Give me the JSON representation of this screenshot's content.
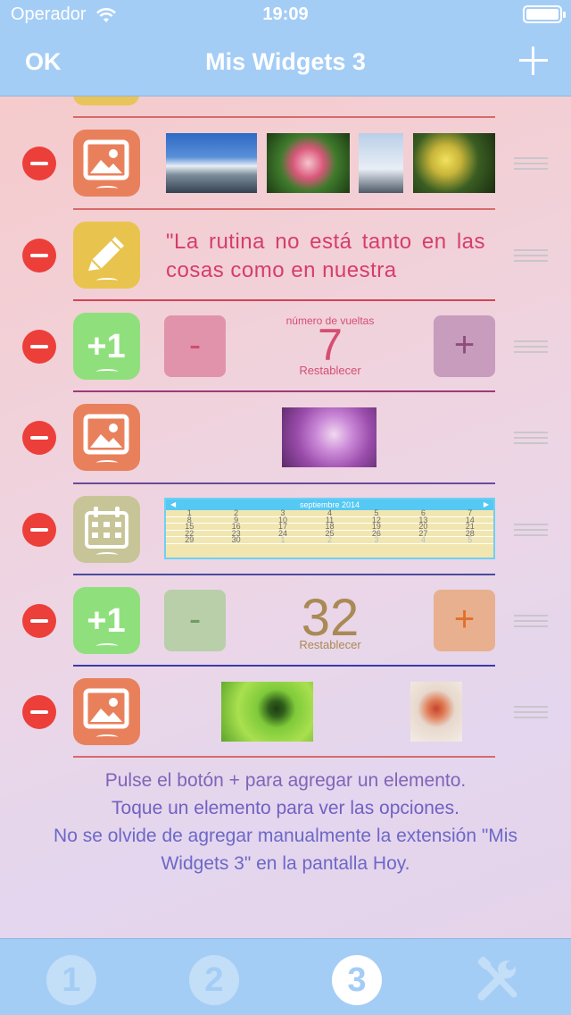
{
  "status_bar": {
    "carrier": "Operador",
    "time": "19:09"
  },
  "nav": {
    "ok_label": "OK",
    "title": "Mis Widgets 3",
    "add_icon": "plus-icon"
  },
  "rows": [
    {
      "type": "images",
      "icon": "image-icon"
    },
    {
      "type": "quote",
      "icon": "pencil-icon",
      "text": "\"La rutina no está tanto en las cosas como en nuestra"
    },
    {
      "type": "counter",
      "icon": "plus-one-icon",
      "label": "número de vueltas",
      "value": "7",
      "reset_label": "Restablecer",
      "minus_label": "-",
      "plus_label": "+"
    },
    {
      "type": "image",
      "icon": "image-icon"
    },
    {
      "type": "calendar",
      "icon": "calendar-icon",
      "month": "septiembre 2014",
      "weeks": [
        [
          "1",
          "2",
          "3",
          "4",
          "5",
          "6",
          "7"
        ],
        [
          "8",
          "9",
          "10",
          "11",
          "12",
          "13",
          "14"
        ],
        [
          "15",
          "16",
          "17",
          "18",
          "19",
          "20",
          "21"
        ],
        [
          "22",
          "23",
          "24",
          "25",
          "26",
          "27",
          "28"
        ],
        [
          "29",
          "30",
          "1",
          "2",
          "3",
          "4",
          "5"
        ]
      ]
    },
    {
      "type": "counter",
      "icon": "plus-one-icon",
      "value": "32",
      "reset_label": "Restablecer",
      "minus_label": "-",
      "plus_label": "+"
    },
    {
      "type": "images",
      "icon": "image-icon"
    }
  ],
  "footer": {
    "line1": "Pulse el botón + para agregar un elemento.",
    "line2": "Toque un elemento para ver las opciones.",
    "line3": "No se olvide de agregar manualmente la extensión \"Mis",
    "line4": "Widgets 3\" en la pantalla Hoy."
  },
  "tabs": [
    {
      "label": "1",
      "selected": false
    },
    {
      "label": "2",
      "selected": false
    },
    {
      "label": "3",
      "selected": true
    },
    {
      "label": "",
      "icon": "tools-icon",
      "selected": false
    }
  ],
  "colors": {
    "header": "#a4cdf6",
    "delete": "#ec3f3a",
    "image_icon": "#e9805c",
    "pencil_icon": "#e8c44e",
    "counter_icon": "#8fe07c",
    "calendar_icon": "#c7c597",
    "quote_text": "#d63d6b"
  }
}
